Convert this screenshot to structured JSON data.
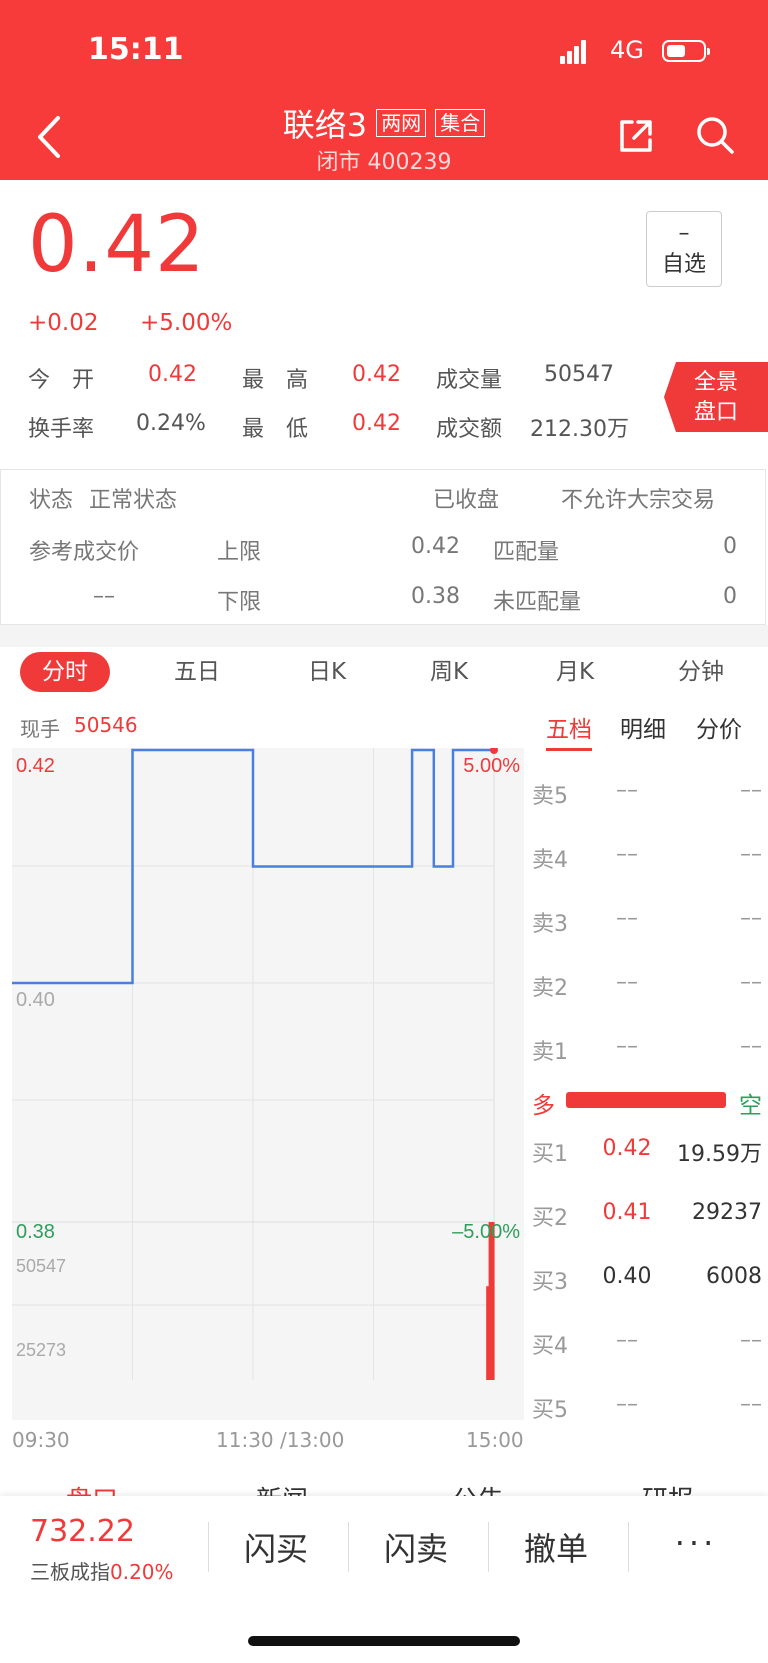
{
  "status_bar": {
    "time": "15:11",
    "network": "4G"
  },
  "header": {
    "title": "联络3",
    "tags": [
      "两网",
      "集合"
    ],
    "subtitle": "闭市 400239"
  },
  "quote": {
    "price": "0.42",
    "change": "+0.02",
    "change_pct": "+5.00%",
    "watch_dash": "–",
    "watch_label": "自选",
    "open_label": "今　开",
    "open": "0.42",
    "high_label": "最　高",
    "high": "0.42",
    "volume_label": "成交量",
    "volume": "50547",
    "turnover_label": "换手率",
    "turnover": "0.24%",
    "low_label": "最　低",
    "low": "0.42",
    "amount_label": "成交额",
    "amount": "212.30万",
    "panorama_line1": "全景",
    "panorama_line2": "盘口"
  },
  "status": {
    "state_label": "状态",
    "state_value": "正常状态",
    "closed": "已收盘",
    "block_trade": "不允许大宗交易",
    "ref_price_label": "参考成交价",
    "ref_price_value": "––",
    "upper_label": "上限",
    "upper_value": "0.42",
    "lower_label": "下限",
    "lower_value": "0.38",
    "matched_label": "匹配量",
    "matched_value": "0",
    "unmatched_label": "未匹配量",
    "unmatched_value": "0"
  },
  "tabs": [
    "分时",
    "五日",
    "日K",
    "周K",
    "月K",
    "分钟"
  ],
  "current_hand": {
    "label": "现手",
    "value": "50546"
  },
  "subtabs": [
    "五档",
    "明细",
    "分价"
  ],
  "chart_data": {
    "type": "line",
    "x_labels": [
      "09:30",
      "11:30 /13:00",
      "15:00"
    ],
    "y_labels": {
      "top": "0.42",
      "mid": "0.40",
      "bottom": "0.38",
      "top_pct": "5.00%",
      "bottom_pct": "–5.00%"
    },
    "ylim": [
      0.38,
      0.42
    ],
    "price_steps": [
      {
        "t": 0,
        "v": 0.4
      },
      {
        "t": 0.25,
        "v": 0.4
      },
      {
        "t": 0.25,
        "v": 0.42
      },
      {
        "t": 0.5,
        "v": 0.42
      },
      {
        "t": 0.5,
        "v": 0.41
      },
      {
        "t": 0.83,
        "v": 0.41
      },
      {
        "t": 0.83,
        "v": 0.42
      },
      {
        "t": 0.875,
        "v": 0.42
      },
      {
        "t": 0.875,
        "v": 0.41
      },
      {
        "t": 0.915,
        "v": 0.41
      },
      {
        "t": 0.915,
        "v": 0.42
      },
      {
        "t": 1,
        "v": 0.42
      }
    ],
    "volume_labels": {
      "max": "50547",
      "mid": "25273"
    },
    "volume_max": 50547,
    "volume_bars": [
      {
        "t": 0.995,
        "v": 50547
      },
      {
        "t": 0.99,
        "v": 30000
      }
    ]
  },
  "order_book": {
    "sells": [
      {
        "label": "卖5",
        "price": "––",
        "vol": "––"
      },
      {
        "label": "卖4",
        "price": "––",
        "vol": "––"
      },
      {
        "label": "卖3",
        "price": "––",
        "vol": "––"
      },
      {
        "label": "卖2",
        "price": "––",
        "vol": "––"
      },
      {
        "label": "卖1",
        "price": "––",
        "vol": "––"
      }
    ],
    "long_label": "多",
    "short_label": "空",
    "buys": [
      {
        "label": "买1",
        "price": "0.42",
        "vol": "19.59万"
      },
      {
        "label": "买2",
        "price": "0.41",
        "vol": "29237"
      },
      {
        "label": "买3",
        "price": "0.40",
        "vol": "6008"
      },
      {
        "label": "买4",
        "price": "––",
        "vol": "––"
      },
      {
        "label": "买5",
        "price": "––",
        "vol": "––"
      }
    ]
  },
  "hidden_tabs": [
    "盘口",
    "新闻",
    "公告",
    "研报"
  ],
  "bottom_bar": {
    "index_value": "732.22",
    "index_name": "三板成指",
    "index_pct": "0.20%",
    "actions": [
      "闪买",
      "闪卖",
      "撤单",
      "···"
    ]
  },
  "colors": {
    "accent": "#f73a3a",
    "up": "#f03a3a",
    "down": "#2e9e5b",
    "line": "#4a7fe0"
  }
}
